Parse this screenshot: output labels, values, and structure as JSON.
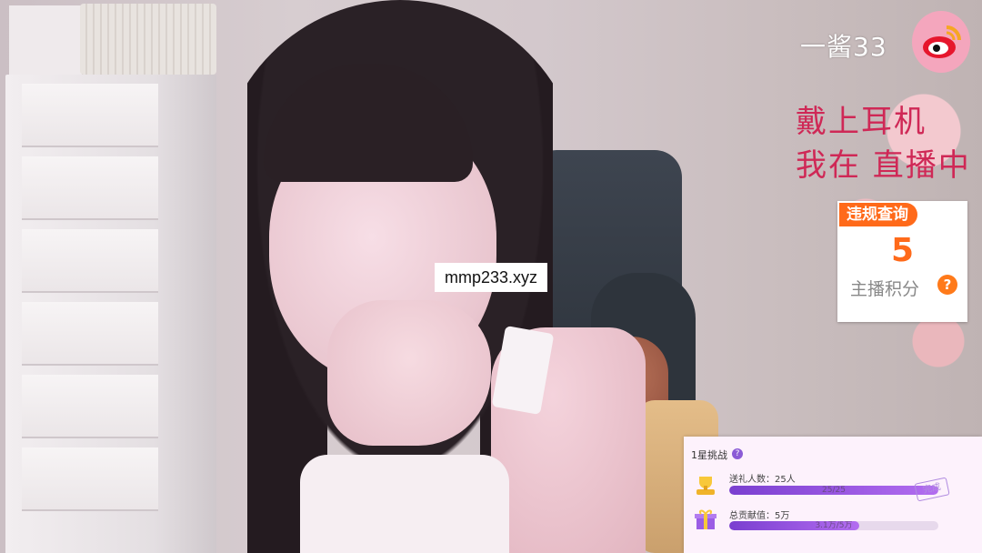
{
  "stream": {
    "streamer_name": "一酱33",
    "badge_icon": "weibo-icon",
    "caption_line1": "戴上耳机",
    "caption_line2": "我在 直播中"
  },
  "report_card": {
    "tag": "违规查询",
    "score": "5",
    "label": "主播积分",
    "help_icon": "?",
    "accent_color": "#ff6a1a"
  },
  "watermark": "mmp233.xyz",
  "challenge": {
    "title": "1星挑战",
    "help_icon": "?",
    "row1": {
      "icon": "trophy-icon",
      "label": "送礼人数：25人",
      "progress_text": "25/25",
      "progress_fraction": 1.0,
      "stamp": "完成"
    },
    "row2": {
      "icon": "gift-icon",
      "label": "总贡献值：5万",
      "progress_text": "3.1万/5万",
      "progress_fraction": 0.62
    }
  }
}
